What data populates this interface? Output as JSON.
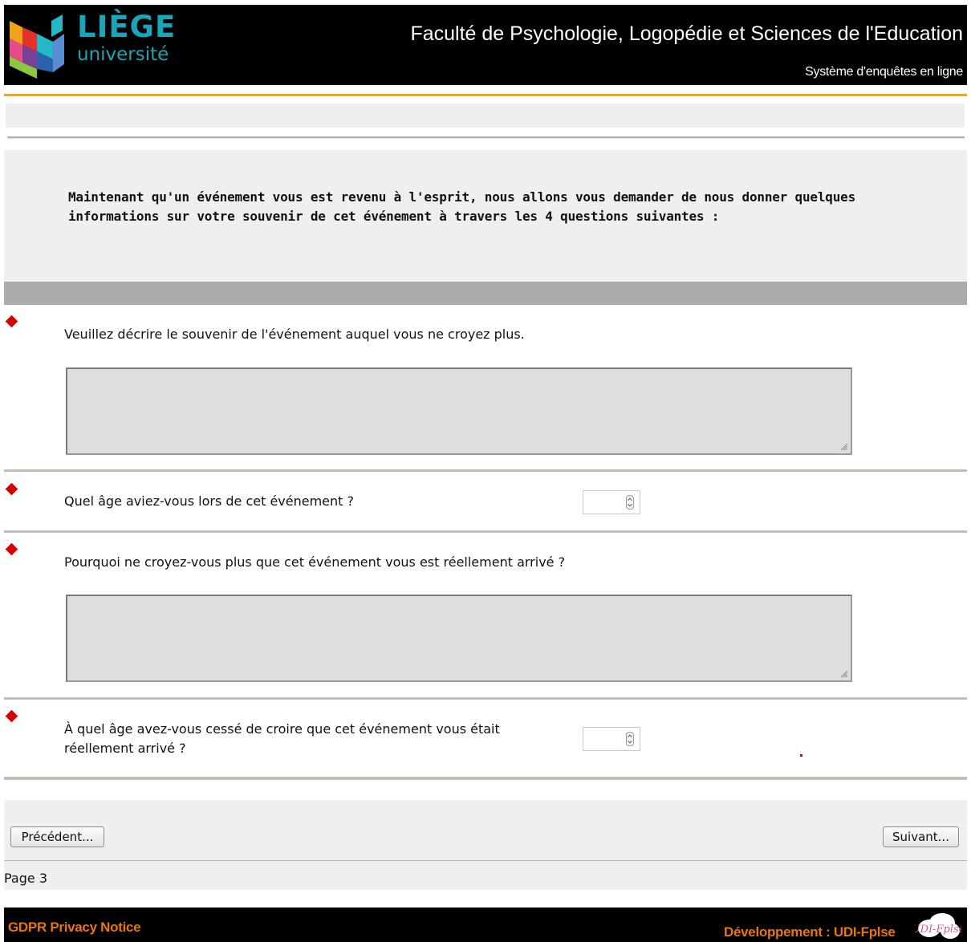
{
  "header": {
    "logo": {
      "line1": "LIÈGE",
      "line2": "université"
    },
    "title": "Faculté de Psychologie, Logopédie et Sciences de l'Education",
    "subtitle": "Système d'enquêtes en ligne"
  },
  "intro": {
    "text": "Maintenant qu'un événement vous est revenu à l'esprit, nous allons vous demander de nous donner quelques informations sur votre souvenir de cet événement à travers les 4 questions suivantes :"
  },
  "questions": [
    {
      "text": "Veuillez décrire le souvenir de l'événement auquel vous ne croyez plus.",
      "type": "textarea",
      "value": ""
    },
    {
      "text": "Quel âge aviez-vous lors de cet événement ?",
      "type": "number",
      "value": ""
    },
    {
      "text": "Pourquoi ne croyez-vous plus que cet événement vous est réellement arrivé ?",
      "type": "textarea",
      "value": ""
    },
    {
      "text": "À quel âge avez-vous cessé de croire que cet événement vous était réellement arrivé ?",
      "type": "number",
      "value": ""
    }
  ],
  "navigation": {
    "previous_label": "Précédent...",
    "next_label": "Suivant...",
    "page_label": "Page 3"
  },
  "footer": {
    "gdpr_label": "GDPR Privacy Notice",
    "dev_label": "Développement : UDI-Fplse",
    "dev_logo_text": "UDI-Fplse"
  },
  "colors": {
    "header_bg": "#000000",
    "accent_orange": "#f7a21b",
    "required_marker": "#d40000",
    "logo_teal": "#1aa5b8",
    "footer_link": "#e8750f"
  }
}
